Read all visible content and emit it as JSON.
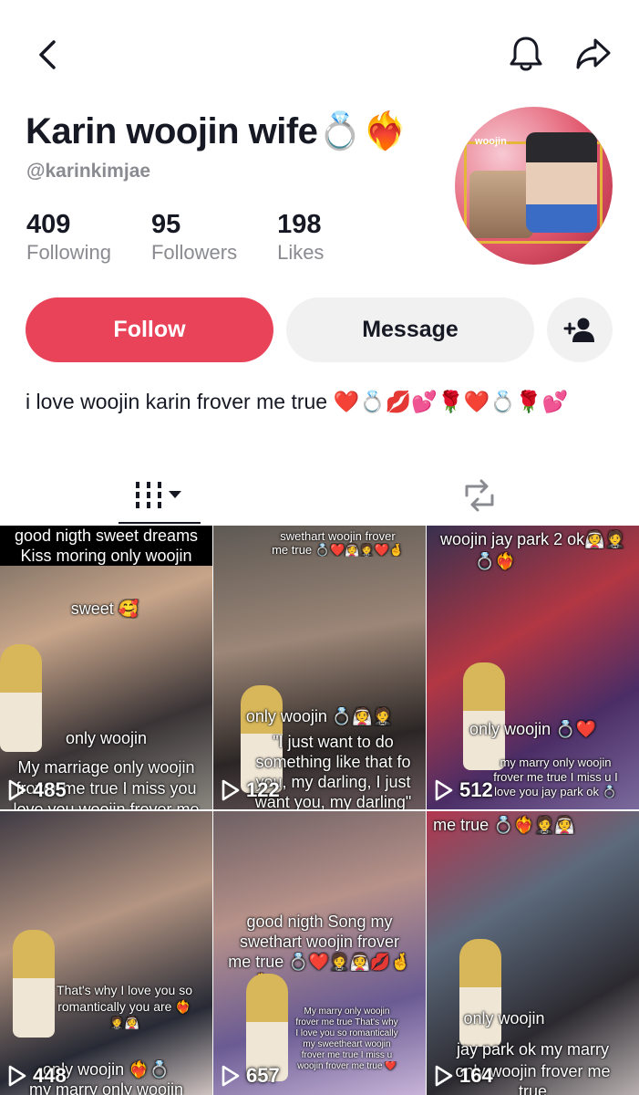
{
  "header": {
    "back_icon": "chevron-left-icon",
    "notification_icon": "bell-icon",
    "share_icon": "share-arrow-icon"
  },
  "profile": {
    "display_name": "Karin woojin wife💍❤️‍🔥",
    "username": "@karinkimjae",
    "avatar_text": "woojin"
  },
  "stats": [
    {
      "value": "409",
      "label": "Following"
    },
    {
      "value": "95",
      "label": "Followers"
    },
    {
      "value": "198",
      "label": "Likes"
    }
  ],
  "actions": {
    "follow_label": "Follow",
    "message_label": "Message",
    "add_friend_icon": "add-person-icon"
  },
  "bio": "i love  woojin karin frover me true ❤️💍💋💕🌹❤️💍🌹💕",
  "tabs": {
    "videos_icon": "grid-videos-icon",
    "reposts_icon": "repost-icon"
  },
  "videos": [
    {
      "views": "485",
      "caption_top": [
        "good nigth sweet dreams",
        "Kiss moring only woojin"
      ],
      "captions": [
        "sweet 🥰",
        "only woojin",
        "My marriage only woojin",
        "frover me true I miss you",
        "love you woojin frover me"
      ]
    },
    {
      "views": "122",
      "caption_top": [
        "swethart woojin frover",
        "me true 💍❤️👰🤵❤️🤞"
      ],
      "captions": [
        "only woojin 💍👰🤵",
        "\"I just want to do",
        "something like that fo",
        "you, my darling, I just",
        "want you, my darling\""
      ]
    },
    {
      "views": "512",
      "caption_top": [
        "woojin  jay park 2 ok👰🤵",
        "💍❤️‍🔥"
      ],
      "captions": [
        "only woojin 💍❤️",
        "my marry only woojin",
        "frover me true I miss u I",
        "love you jay park ok 💍"
      ]
    },
    {
      "views": "448",
      "caption_top": [],
      "captions": [
        "That's why I love you so",
        "romantically you are ❤️‍🔥",
        "🤵👰",
        "only woojin ❤️‍🔥💍",
        "my marry only woojin"
      ]
    },
    {
      "views": "657",
      "caption_top": [],
      "captions": [
        "good nigth Song my",
        "swethart woojin frover",
        "me true 💍❤️🤵👰💋🤞",
        "🤞",
        "My marry only woojin",
        "frover me true That's why",
        "I love you so romantically",
        "my sweetheart woojin",
        "frover me true I miss u",
        "woojin frover me true ❤️"
      ]
    },
    {
      "views": "164",
      "caption_top": [
        "me true 💍❤️‍🔥🤵👰"
      ],
      "captions": [
        "only woojin",
        "jay park  ok my marry",
        "only woojin frover me",
        "true"
      ]
    }
  ]
}
